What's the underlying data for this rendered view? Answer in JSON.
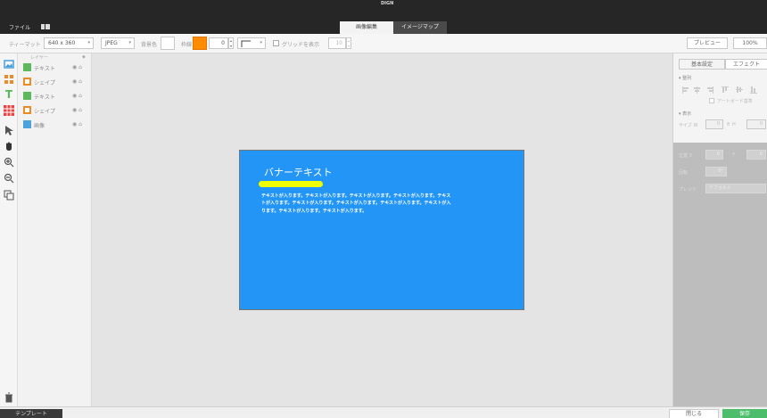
{
  "app": {
    "brand": "DIGN"
  },
  "menu": {
    "file": "ファイル",
    "grid_icon": "grid-icon"
  },
  "modes": [
    {
      "label": "画像編集",
      "active": true
    },
    {
      "label": "イメージマップ",
      "active": false
    }
  ],
  "toolbar": {
    "preset_label": "ティーマット",
    "size": "640 x 360",
    "format": "JPEG",
    "bg_label": "背景色",
    "bg_color": "#ffffff",
    "line_label": "枠線",
    "line_color": "#ff8c00",
    "line_width": "0",
    "grid_label": "グリッドを表示",
    "grid_size": "10",
    "preview": "プレビュー",
    "zoom": "100%"
  },
  "layers": {
    "header": "レイヤー",
    "items": [
      {
        "name": "テキスト",
        "color": "#5cb85c"
      },
      {
        "name": "シェイプ",
        "color": "#f08a24"
      },
      {
        "name": "テキスト",
        "color": "#5cb85c"
      },
      {
        "name": "シェイプ",
        "color": "#f08a24"
      },
      {
        "name": "画像",
        "color": "#4aa3df"
      }
    ]
  },
  "banner": {
    "title": "バナーテキスト",
    "body": "テキストが入ります。テキストが入ります。テキストが入ります。テキストが入ります。テキストが入ります。テキストが入ります。テキストが入ります。テキストが入ります。テキストが入ります。テキストが入ります。テキストが入ります。",
    "bg_color": "#2395f7",
    "bar_color": "#f0ff00"
  },
  "right_panel": {
    "tab_basic": "基本設定",
    "tab_effect": "エフェクト",
    "sec_align": "整列",
    "artboard": "アートボード基準",
    "sec_display": "表示",
    "size_label": "サイズ",
    "w_label": "W",
    "h_label": "H",
    "w_val": "0",
    "h_val": "0",
    "pos_label": "位置",
    "x_label": "X",
    "y_label": "Y",
    "x_val": "0",
    "y_val": "0",
    "rot_label": "回転",
    "rot_val": "0°",
    "blend_label": "ブレンド",
    "blend_val": "デフォルト"
  },
  "footer": {
    "template": "テンプレート",
    "close": "閉じる",
    "save": "保存"
  }
}
